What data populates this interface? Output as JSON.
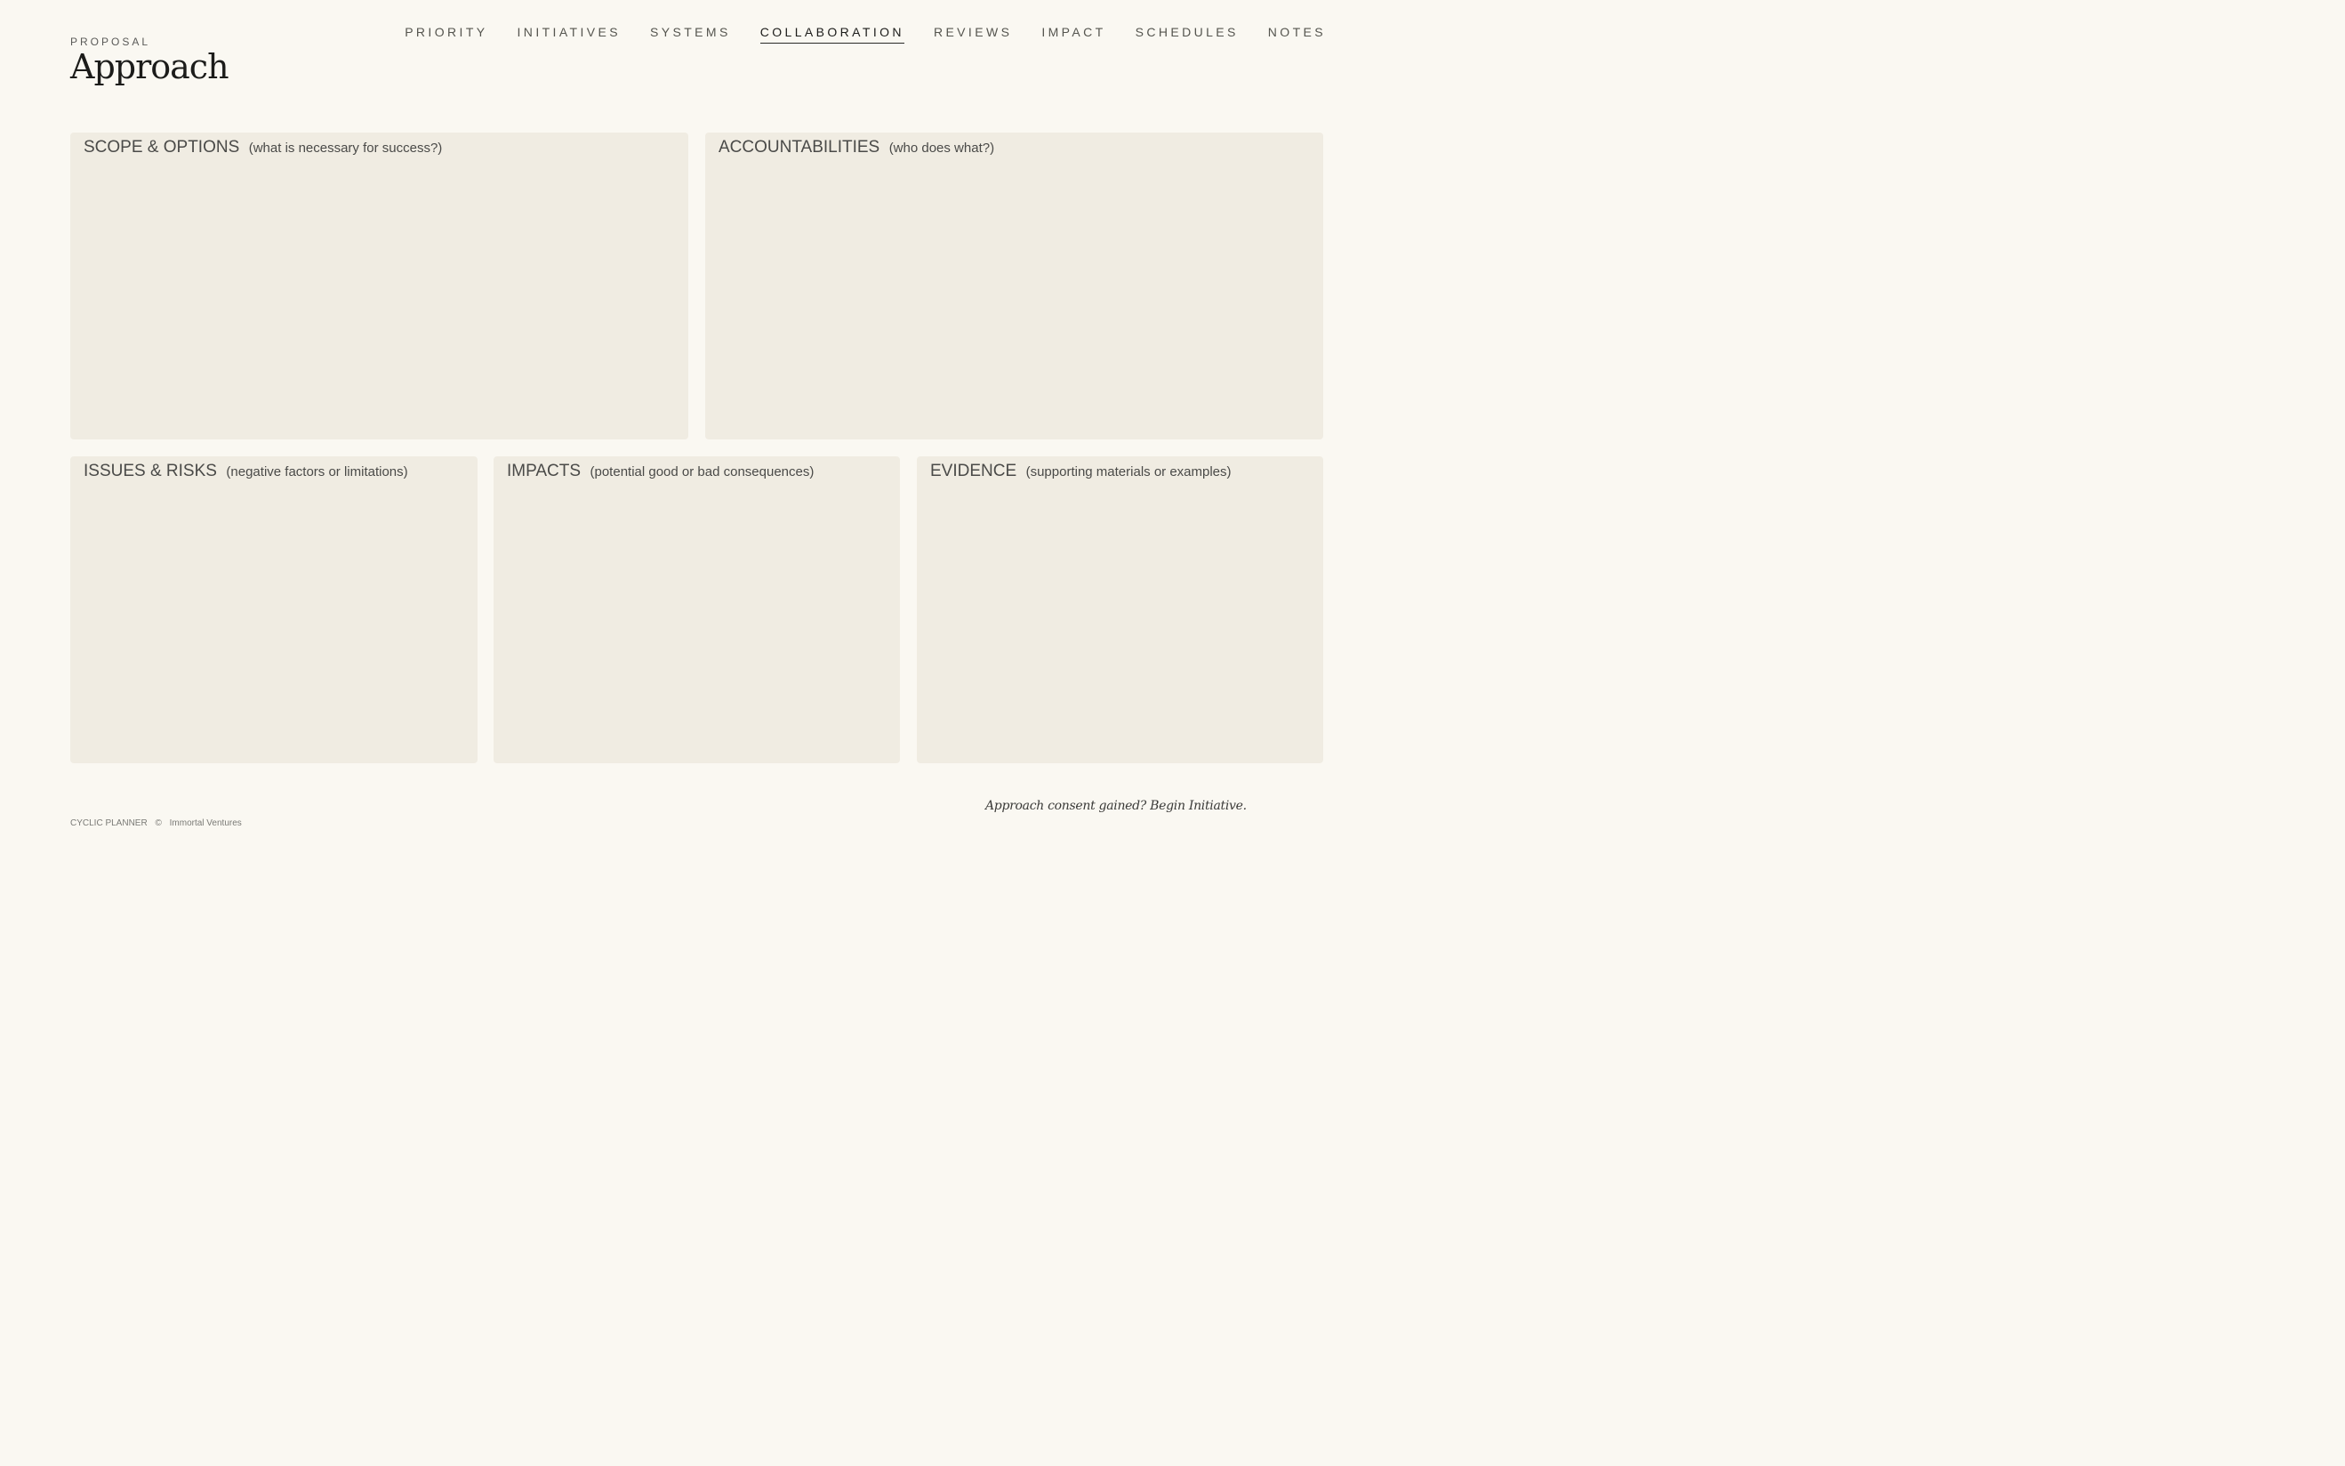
{
  "header": {
    "eyebrow": "PROPOSAL",
    "title": "Approach"
  },
  "nav": {
    "items": [
      "PRIORITY",
      "INITIATIVES",
      "SYSTEMS",
      "COLLABORATION",
      "REVIEWS",
      "IMPACT",
      "SCHEDULES",
      "NOTES"
    ],
    "active": "COLLABORATION"
  },
  "panels": [
    {
      "title": "SCOPE & OPTIONS",
      "subtitle": "(what is necessary for success?)"
    },
    {
      "title": "ACCOUNTABILITIES",
      "subtitle": "(who does what?)"
    },
    {
      "title": "ISSUES & RISKS",
      "subtitle": "(negative factors or limitations)"
    },
    {
      "title": "IMPACTS",
      "subtitle": "(potential good or bad consequences)"
    },
    {
      "title": "EVIDENCE",
      "subtitle": "(supporting materials or examples)"
    }
  ],
  "footer": {
    "app_name": "CYCLIC PLANNER",
    "copyright_symbol": "©",
    "company": "Immortal Ventures",
    "cta": "Approach consent gained?  Begin Initiative."
  },
  "colors": {
    "background": "#faf8f2",
    "panel": "#f0ece2",
    "text": "#4a4a48",
    "heading": "#1c1c1a"
  }
}
